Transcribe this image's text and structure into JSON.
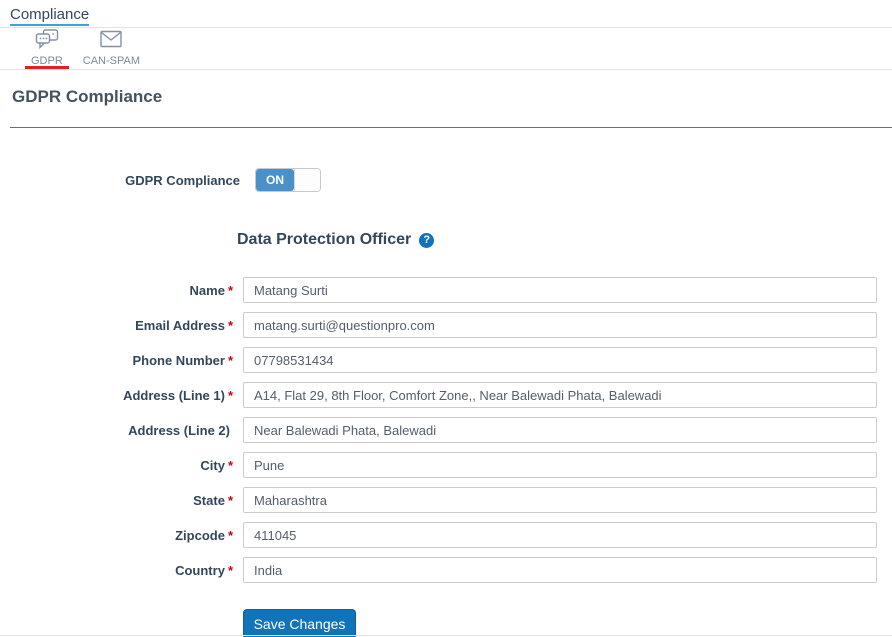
{
  "breadcrumb": {
    "label": "Compliance"
  },
  "tabs": [
    {
      "label": "GDPR",
      "icon": "gdpr-chat-bubbles-icon",
      "active": true
    },
    {
      "label": "CAN-SPAM",
      "icon": "envelope-icon",
      "active": false
    }
  ],
  "page": {
    "title": "GDPR Compliance"
  },
  "toggle": {
    "label": "GDPR Compliance",
    "state": "ON"
  },
  "section": {
    "title": "Data Protection Officer",
    "help_glyph": "?"
  },
  "form": {
    "required_marker": "*",
    "fields": [
      {
        "label": "Name",
        "required": true,
        "value": "Matang Surti"
      },
      {
        "label": "Email Address",
        "required": true,
        "value": "matang.surti@questionpro.com"
      },
      {
        "label": "Phone Number",
        "required": true,
        "value": "07798531434"
      },
      {
        "label": "Address (Line 1)",
        "required": true,
        "value": "A14, Flat 29, 8th Floor, Comfort Zone,, Near Balewadi Phata, Balewadi"
      },
      {
        "label": "Address (Line 2)",
        "required": false,
        "value": "Near Balewadi Phata, Balewadi"
      },
      {
        "label": "City",
        "required": true,
        "value": "Pune"
      },
      {
        "label": "State",
        "required": true,
        "value": "Maharashtra"
      },
      {
        "label": "Zipcode",
        "required": true,
        "value": "411045"
      },
      {
        "label": "Country",
        "required": true,
        "value": "India"
      }
    ],
    "save_label": "Save Changes"
  },
  "colors": {
    "accent_blue": "#1173b8",
    "toggle_blue": "#4a90c9",
    "tab_active_red": "#e71d23",
    "link_underline": "#39a3dc",
    "heading_text": "#33475b",
    "required_red": "#cc0011"
  }
}
